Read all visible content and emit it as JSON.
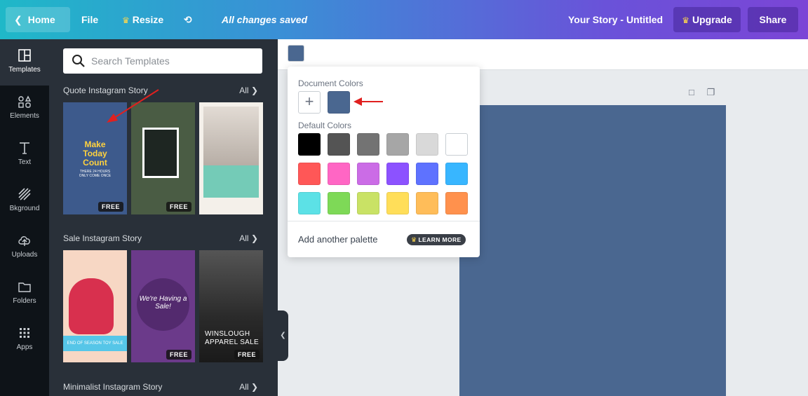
{
  "topbar": {
    "home_label": "Home",
    "file_label": "File",
    "resize_label": "Resize",
    "saved_text": "All changes saved",
    "doc_title": "Your Story - Untitled",
    "upgrade_label": "Upgrade",
    "share_label": "Share"
  },
  "rail": {
    "items": [
      {
        "label": "Templates"
      },
      {
        "label": "Elements"
      },
      {
        "label": "Text"
      },
      {
        "label": "Bkground"
      },
      {
        "label": "Uploads"
      },
      {
        "label": "Folders"
      },
      {
        "label": "Apps"
      }
    ]
  },
  "search": {
    "placeholder": "Search Templates"
  },
  "sections": [
    {
      "title": "Quote Instagram Story",
      "all": "All",
      "thumbs": [
        {
          "text_big": "Make\nToday\nCount",
          "text_small": "THERE 24 HOURS\nONLY COME ONCE",
          "badge": "FREE"
        },
        {
          "badge": "FREE"
        },
        {}
      ]
    },
    {
      "title": "Sale Instagram Story",
      "all": "All",
      "thumbs": [
        {
          "text": "END OF SEASON TOY SALE"
        },
        {
          "text": "We're Having a Sale!",
          "badge": "FREE"
        },
        {
          "text": "WINSLOUGH\nAPPAREL SALE",
          "badge": "FREE"
        }
      ]
    },
    {
      "title": "Minimalist Instagram Story",
      "all": "All"
    }
  ],
  "colors": {
    "current": "#4a6790",
    "document_title": "Document Colors",
    "document": [
      "#4a6790"
    ],
    "default_title": "Default Colors",
    "default": [
      "#000000",
      "#545454",
      "#737373",
      "#a6a6a6",
      "#d9d9d9",
      "#ffffff",
      "#ff5757",
      "#ff66c4",
      "#cb6ce6",
      "#8c52ff",
      "#5e72ff",
      "#38b6ff",
      "#5ce1e6",
      "#7ed957",
      "#c9e265",
      "#ffde59",
      "#ffbd59",
      "#ff914d"
    ],
    "add_palette_label": "Add another palette",
    "learn_more_label": "LEARN MORE"
  },
  "annotation_color": "#e0201f"
}
